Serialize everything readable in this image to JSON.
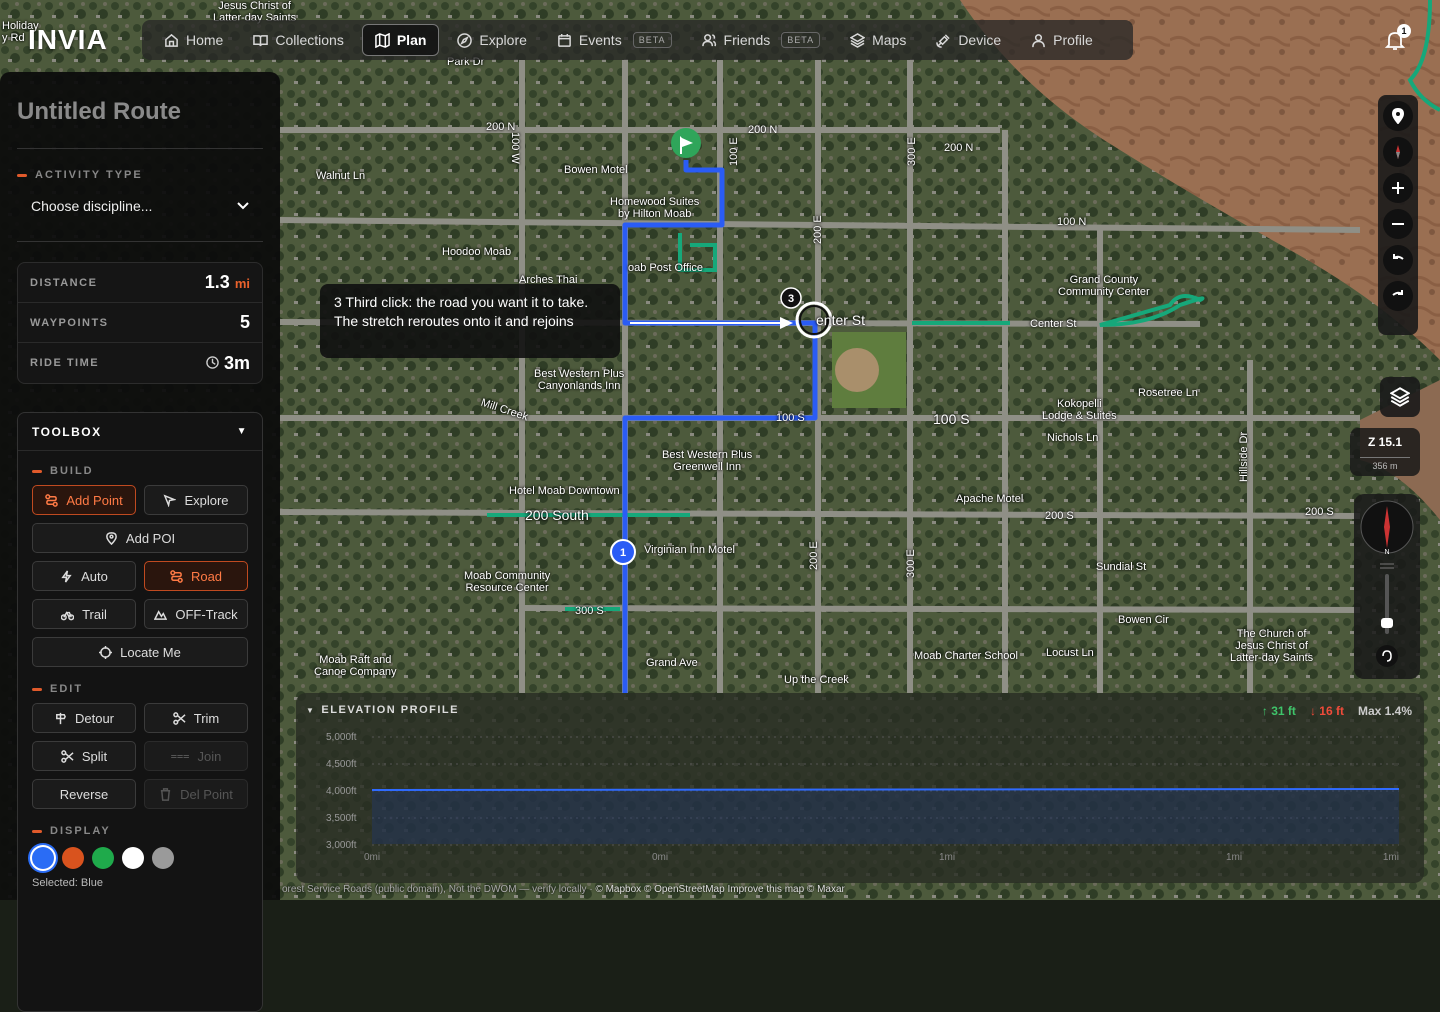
{
  "app": {
    "logo": "INVIA",
    "notification_count": "1"
  },
  "nav": [
    {
      "label": "Home",
      "icon": "home-icon"
    },
    {
      "label": "Collections",
      "icon": "book-icon"
    },
    {
      "label": "Plan",
      "icon": "map-icon",
      "active": true
    },
    {
      "label": "Explore",
      "icon": "compass-icon"
    },
    {
      "label": "Events",
      "icon": "calendar-icon",
      "badge": "BETA"
    },
    {
      "label": "Friends",
      "icon": "users-icon",
      "badge": "BETA"
    },
    {
      "label": "Maps",
      "icon": "layers-icon"
    },
    {
      "label": "Device",
      "icon": "satellite-icon"
    },
    {
      "label": "Profile",
      "icon": "user-icon"
    }
  ],
  "panel": {
    "title": "Untitled Route",
    "activity_label": "ACTIVITY TYPE",
    "activity_value": "Choose discipline...",
    "stats": {
      "distance_label": "DISTANCE",
      "distance_value": "1.3",
      "distance_unit": "mi",
      "waypoints_label": "WAYPOINTS",
      "waypoints_value": "5",
      "ride_time_label": "RIDE TIME",
      "ride_time_value": "3m"
    },
    "toolbox": {
      "title": "TOOLBOX",
      "build_label": "BUILD",
      "add_point": "Add Point",
      "explore": "Explore",
      "add_poi": "Add POI",
      "auto": "Auto",
      "road": "Road",
      "trail": "Trail",
      "off_track": "OFF-Track",
      "locate_me": "Locate Me",
      "edit_label": "EDIT",
      "detour": "Detour",
      "trim": "Trim",
      "split": "Split",
      "join": "Join",
      "reverse": "Reverse",
      "del_point": "Del Point",
      "display_label": "DISPLAY",
      "colors": [
        "#2a6cf5",
        "#d9531e",
        "#1faa4b",
        "#ffffff",
        "#9a9a9a"
      ],
      "selected_text": "Selected: Blue"
    }
  },
  "tooltip": "3 Third click: the road you want it to take. The stretch reroutes onto it and rejoins",
  "map": {
    "zoom": "Z 15.1",
    "scale": "356 m",
    "labels": {
      "park_dr": "Park Dr",
      "walnut_ln": "Walnut Ln",
      "n200_a": "200 N",
      "n200_b": "200 N",
      "n200_c": "200 N",
      "w100": "100 W",
      "e100": "100 E",
      "e200": "200 E",
      "e300": "300 E",
      "n100": "100 N",
      "bowen_motel": "Bowen Motel",
      "homewood": "Homewood Suites\nby Hilton Moab",
      "hoodoo": "Hoodoo Moab",
      "arches_thai": "Arches Thai",
      "moab_post": "oab Post Office",
      "center_st": "enter St",
      "center_st2": "Center St",
      "grand_county": "Grand County\nCommunity Center",
      "bw_canyonlands": "Best Western Plus\nCanyonlands Inn",
      "mill_creek": "Mill Creek",
      "s100": "100 S",
      "bw_greenwell": "Best Western Plus\nGreenwell Inn",
      "hotel_moab": "Hotel Moab Downtown",
      "s200_south": "200 South",
      "virginian": "Virginian Inn Motel",
      "moab_community": "Moab Community\nResource Center",
      "e200_b": "200 E",
      "e300_b": "300 E",
      "s200_a": "200 S",
      "s200_b": "200 S",
      "kokopelli": "Kokopelli\nLodge & Suites",
      "nichols": "Nichols Ln",
      "rosetree": "Rosetree Ln",
      "apache": "Apache Motel",
      "sundial": "Sundial St",
      "bowen_cir": "Bowen Cir",
      "church": "The Church of\nJesus Christ of\nLatter-day Saints",
      "charter": "Moab Charter School",
      "locust": "Locust Ln",
      "grand_ave": "Grand Ave",
      "up_creek": "Up the Creek",
      "raft": "Moab Raft and\nCanoe Company",
      "hillside": "Hillside Dr",
      "church_top": "Jesus Christ of\nLatter-day Saints",
      "holiday": "Holiday\ny Rd",
      "s300": "300 S",
      "s100_b": "100 S"
    }
  },
  "elevation": {
    "title": "ELEVATION PROFILE",
    "gain": "31 ft",
    "loss": "16 ft",
    "max_grade": "Max 1.4%",
    "y_ticks": [
      "5,000ft",
      "4,500ft",
      "4,000ft",
      "3,500ft",
      "3,000ft"
    ],
    "x_ticks": [
      "0mi",
      "0mi",
      "1mi",
      "1mi",
      "1mi"
    ]
  },
  "attribution": "© Mapbox © OpenStreetMap  Improve this map  © Maxar"
}
